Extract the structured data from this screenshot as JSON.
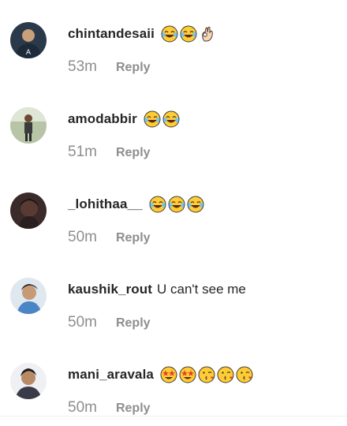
{
  "comments": [
    {
      "username": "chintandesaii",
      "text": "",
      "emojis": [
        "tears-of-joy",
        "tears-of-joy",
        "ok-hand"
      ],
      "time": "53m",
      "reply": "Reply"
    },
    {
      "username": "amodabbir",
      "text": "",
      "emojis": [
        "tears-of-joy",
        "tears-of-joy"
      ],
      "time": "51m",
      "reply": "Reply"
    },
    {
      "username": "_lohithaa__",
      "text": "",
      "emojis": [
        "tears-of-joy",
        "tears-of-joy",
        "tears-of-joy"
      ],
      "time": "50m",
      "reply": "Reply"
    },
    {
      "username": "kaushik_rout",
      "text": "U can't see me",
      "emojis": [],
      "time": "50m",
      "reply": "Reply"
    },
    {
      "username": "mani_aravala",
      "text": "",
      "emojis": [
        "star-struck",
        "star-struck",
        "face-blowing-kiss",
        "face-blowing-kiss",
        "face-blowing-kiss"
      ],
      "time": "50m",
      "reply": "Reply"
    }
  ]
}
